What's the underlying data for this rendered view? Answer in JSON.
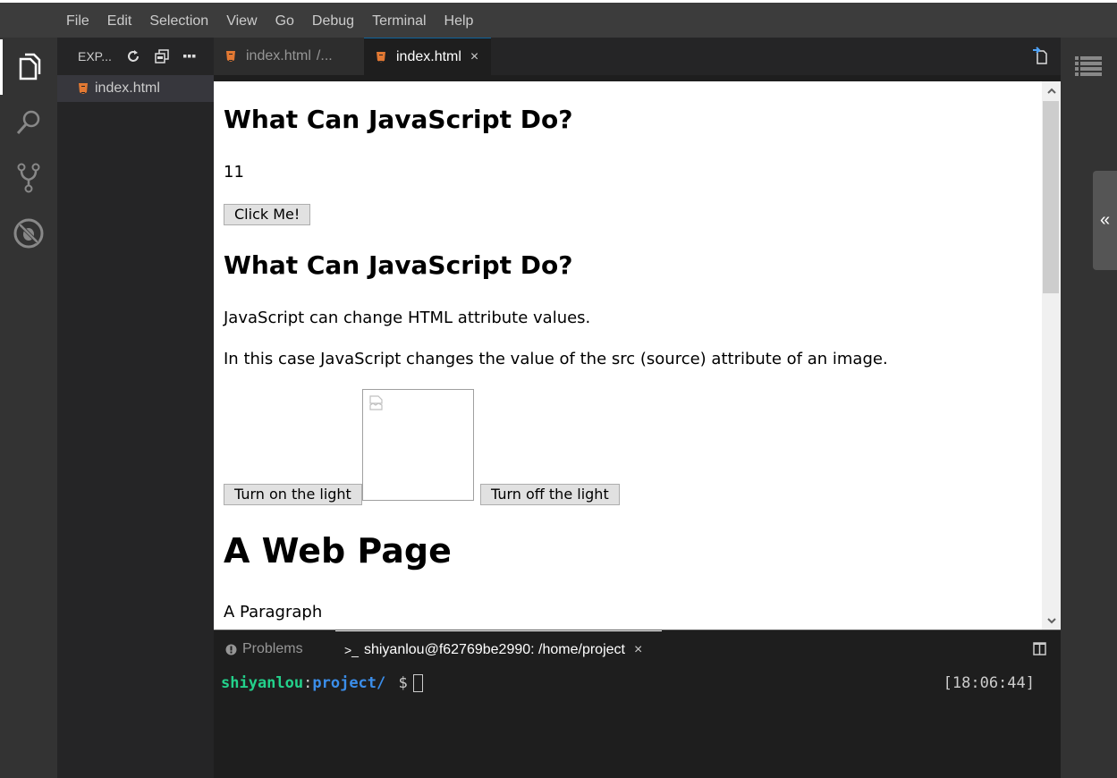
{
  "menu": [
    "File",
    "Edit",
    "Selection",
    "View",
    "Go",
    "Debug",
    "Terminal",
    "Help"
  ],
  "activity": [
    {
      "name": "explorer",
      "icon": "files-icon",
      "active": true
    },
    {
      "name": "search",
      "icon": "search-icon"
    },
    {
      "name": "scm",
      "icon": "source-control-icon"
    },
    {
      "name": "debug",
      "icon": "debug-icon"
    }
  ],
  "sidebar": {
    "title": "EXP...",
    "files": [
      {
        "name": "index.html",
        "icon": "html5-icon"
      }
    ]
  },
  "tabs": [
    {
      "label": "index.html",
      "suffix": "/...",
      "active": false
    },
    {
      "label": "index.html",
      "close": "×",
      "active": true
    }
  ],
  "preview": {
    "heading1": "What Can JavaScript Do?",
    "counter": "11",
    "click_button": "Click Me!",
    "heading2": "What Can JavaScript Do?",
    "para1": "JavaScript can change HTML attribute values.",
    "para2": "In this case JavaScript changes the value of the src (source) attribute of an image.",
    "turn_on": "Turn on the light",
    "turn_off": "Turn off the light",
    "heading3": "A Web Page",
    "para3": "A Paragraph"
  },
  "panel": {
    "problems_label": "Problems",
    "terminal_label": "shiyanlou@f62769be2990: /home/project",
    "terminal_close": "×",
    "prompt_user": "shiyanlou",
    "prompt_colon": ":",
    "prompt_path": "project/",
    "prompt_dollar": "$",
    "clock": "[18:06:44]"
  },
  "colors": {
    "accent": "#0e639c",
    "html_icon": "#e37933",
    "term_green": "#23d18b",
    "term_blue": "#3b8eea"
  }
}
